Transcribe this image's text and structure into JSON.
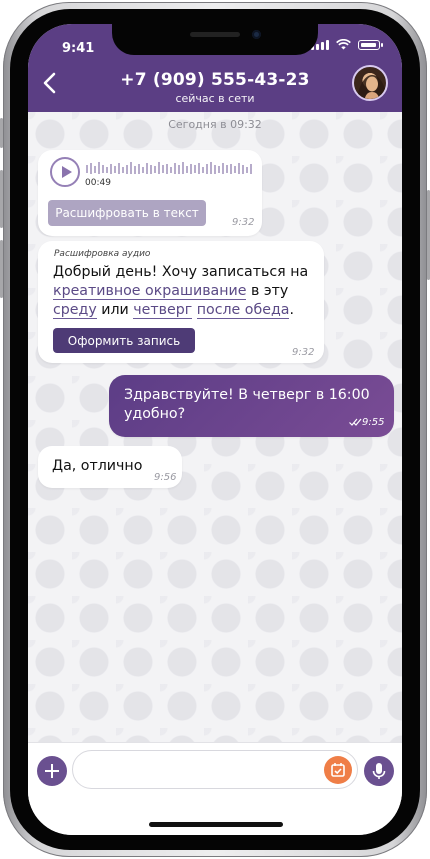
{
  "status_bar": {
    "time": "9:41"
  },
  "header": {
    "title": "+7 (909) 555-43-23",
    "subtitle": "сейчас в сети",
    "back_icon": "chevron-left-icon",
    "avatar_icon": "contact-avatar"
  },
  "chat": {
    "date_separator": "Сегодня в 09:32",
    "messages": [
      {
        "type": "voice",
        "duration": "00:49",
        "decode_button": "Расшифровать в текст",
        "time": "9:32"
      },
      {
        "type": "transcript",
        "header": "Расшифровка аудио",
        "text_parts": {
          "p1": "Добрый день! Хочу записаться на ",
          "link1": "креативное окрашивание",
          "p2": " в эту ",
          "link2": "среду",
          "p3": " или ",
          "link3": "четверг",
          "p4": " ",
          "link4": "после обеда",
          "p5": "."
        },
        "book_button": "Оформить запись",
        "time": "9:32"
      },
      {
        "type": "outgoing",
        "text": "Здравствуйте! В четверг в 16:00 удобно?",
        "time": "9:55",
        "status_icon": "double-check-icon"
      },
      {
        "type": "incoming",
        "text": "Да, отлично",
        "time": "9:56"
      }
    ]
  },
  "input_bar": {
    "placeholder": "",
    "plus_icon": "plus-icon",
    "calendar_icon": "calendar-check-icon",
    "mic_icon": "microphone-icon"
  },
  "colors": {
    "header_bg": "#5b3e84",
    "accent": "#6a5090",
    "outgoing_bubble": "#6b4691",
    "calendar_button": "#ef7e47"
  }
}
